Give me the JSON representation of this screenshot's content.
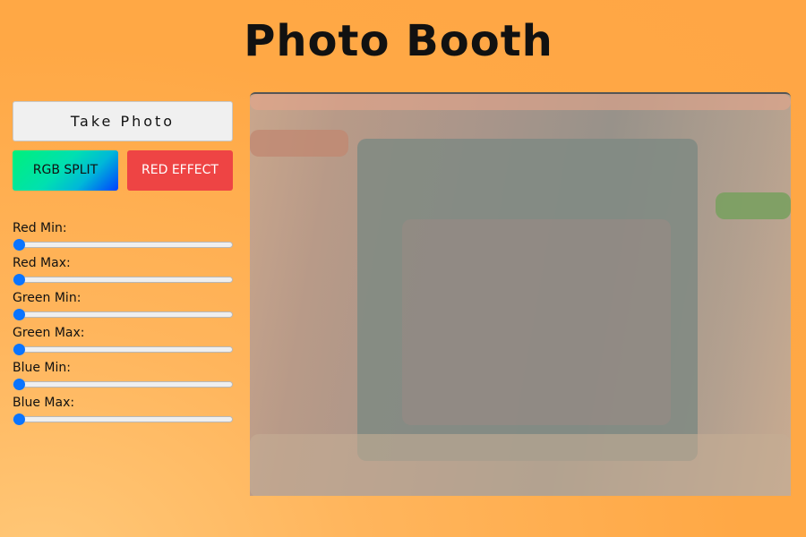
{
  "title": "Photo Booth",
  "buttons": {
    "take_photo": "Take Photo",
    "rgb_split": "RGB SPLIT",
    "red_effect": "RED EFFECT"
  },
  "sliders": [
    {
      "label": "Red Min:",
      "value": 0
    },
    {
      "label": "Red Max:",
      "value": 0
    },
    {
      "label": "Green Min:",
      "value": 0
    },
    {
      "label": "Green Max:",
      "value": 0
    },
    {
      "label": "Blue Min:",
      "value": 0
    },
    {
      "label": "Blue Max:",
      "value": 0
    }
  ],
  "colors": {
    "background": "#ffa845",
    "red_button": "#ee4444",
    "slider_thumb": "#0a74ff"
  }
}
